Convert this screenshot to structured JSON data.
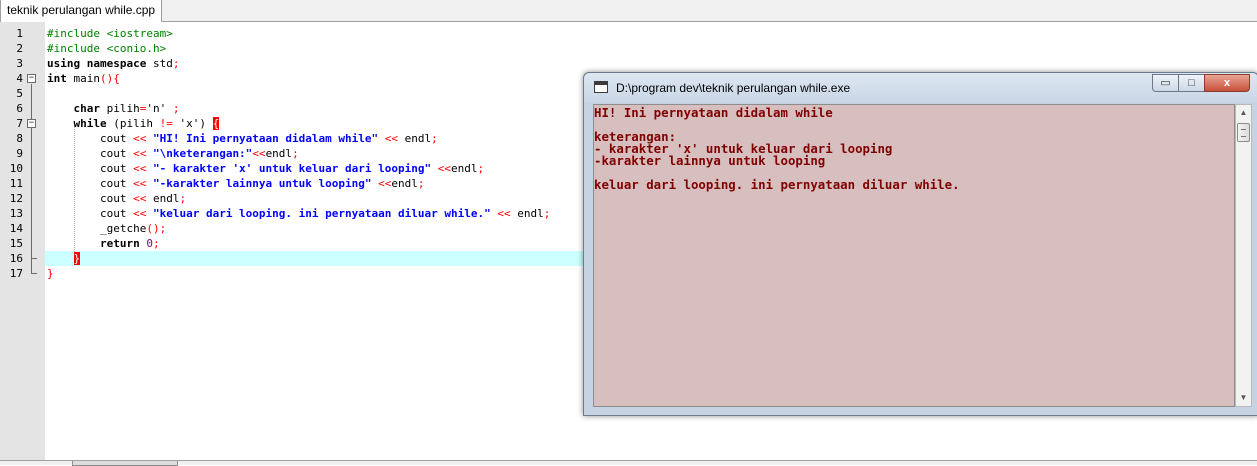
{
  "editor": {
    "tab_label": "teknik perulangan while.cpp",
    "line_numbers": [
      "1",
      "2",
      "3",
      "4",
      "5",
      "6",
      "7",
      "8",
      "9",
      "10",
      "11",
      "12",
      "13",
      "14",
      "15",
      "16",
      "17"
    ],
    "fold_markers": [
      "−",
      "−"
    ],
    "current_line": 16,
    "highlight_color": "#ccffff",
    "code": {
      "l1": [
        "#include <iostream>"
      ],
      "l2": [
        "#include <conio.h>"
      ],
      "l3": [
        "using namespace",
        " std",
        ";"
      ],
      "l4": [
        "int",
        " main",
        "(){"
      ],
      "l6": [
        "    ",
        "char",
        " pilih",
        "=",
        "'n'",
        " ;"
      ],
      "l7": [
        "    ",
        "while",
        " (",
        "pilih ",
        "!=",
        " ",
        "'x'",
        ") ",
        "{"
      ],
      "l8": [
        "        cout ",
        "<<",
        " ",
        "\"HI! Ini pernyataan didalam while\"",
        " ",
        "<<",
        " endl",
        ";"
      ],
      "l9": [
        "        cout ",
        "<<",
        " ",
        "\"\\nketerangan:\"",
        "<<",
        "endl",
        ";"
      ],
      "l10": [
        "        cout ",
        "<<",
        " ",
        "\"- karakter 'x' untuk keluar dari looping\"",
        " ",
        "<<",
        "endl",
        ";"
      ],
      "l11": [
        "        cout ",
        "<<",
        " ",
        "\"-karakter lainnya untuk looping\"",
        " ",
        "<<",
        "endl",
        ";"
      ],
      "l12": [
        "        cout ",
        "<<",
        " endl",
        ";"
      ],
      "l13": [
        "        cout ",
        "<<",
        " ",
        "\"keluar dari looping. ini pernyataan diluar while.\"",
        " ",
        "<<",
        " endl",
        ";"
      ],
      "l14": [
        "        _getche",
        "();"
      ],
      "l15": [
        "        ",
        "return",
        " ",
        "0",
        ";"
      ],
      "l16": [
        "    ",
        "}"
      ],
      "l17": [
        "}"
      ]
    }
  },
  "console": {
    "title": "D:\\program dev\\teknik perulangan while.exe",
    "buttons": {
      "minimize": "▭",
      "maximize": "□",
      "close": "x"
    },
    "output_lines": [
      "HI! Ini pernyataan didalam while",
      "",
      "keterangan:",
      "- karakter 'x' untuk keluar dari looping",
      "-karakter lainnya untuk looping",
      "",
      "keluar dari looping. ini pernyataan diluar while."
    ],
    "background_color": "#d7bfc0",
    "text_color": "#800000",
    "scroll_up": "▲",
    "scroll_down": "▼"
  }
}
